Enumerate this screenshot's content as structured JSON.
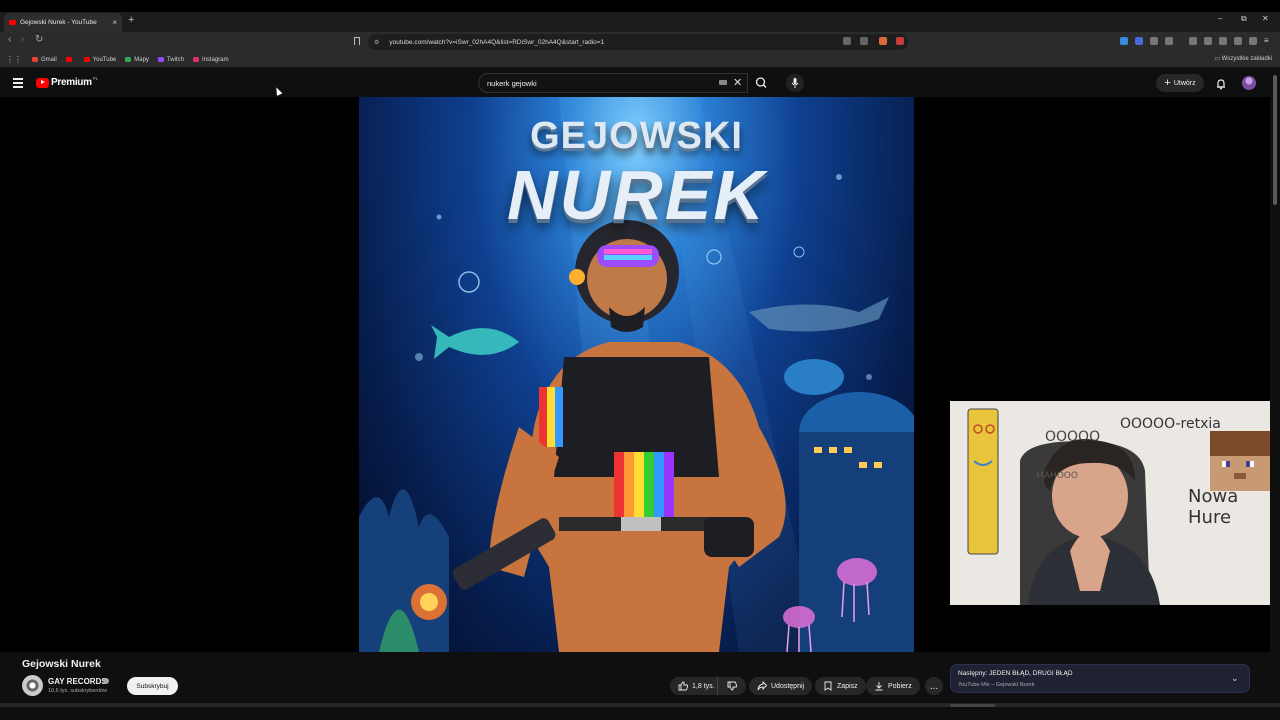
{
  "browser": {
    "tab_title": "Gejowski Nurek - YouTube",
    "url": "youtube.com/watch?v=iSwr_02hA4Q&list=RDiSwr_02hA4Q&start_radio=1",
    "bookmarks": [
      {
        "label": "Gmail",
        "color": "#ea4335"
      },
      {
        "label": "",
        "color": "#ff0000"
      },
      {
        "label": "YouTube",
        "color": "#ff0000"
      },
      {
        "label": "Mapy",
        "color": "#34a853"
      },
      {
        "label": "Twitch",
        "color": "#9146ff"
      },
      {
        "label": "Instagram",
        "color": "#e1306c"
      }
    ],
    "all_bookmarks": "Wszystkie zakładki"
  },
  "youtube": {
    "logo_text": "Premium",
    "logo_region": "PL",
    "search_value": "nukerk gejowki",
    "create_label": "Utwórz"
  },
  "thumbnail": {
    "title_line1": "GEJOWSKI",
    "title_line2": "NUREK"
  },
  "webcam": {
    "text1": "OOOOO-retxia",
    "text2": "OOOOO",
    "text3": "Nowa Hure",
    "text4": "MAHOOO"
  },
  "video": {
    "title": "Gejowski Nurek",
    "channel_name": "GAY RECORDS",
    "subscribers": "10,6 tys. subskrybentów",
    "subscribe_label": "Subskrybuj",
    "likes": "1,8 tys.",
    "share_label": "Udostępnij",
    "save_label": "Zapisz",
    "download_label": "Pobierz",
    "more_label": "..."
  },
  "next_up": {
    "title": "Następny: JEDEN BŁĄD, DRUGI BŁĄD",
    "subtitle": "YouTube Mix – Gejowski Nurek"
  },
  "colors": {
    "brand_red": "#ff0000",
    "background": "#0f0f0f",
    "chip": "#272727"
  }
}
